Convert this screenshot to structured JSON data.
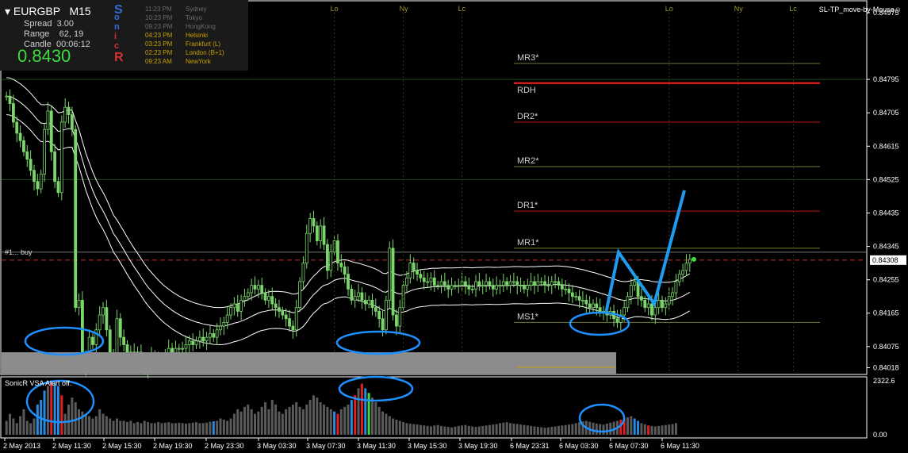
{
  "header": {
    "symbol": "EURGBP",
    "timeframe": "M15",
    "spread_label": "Spread",
    "spread_value": "3.00",
    "range_label": "Range",
    "range_value": "62, 19",
    "candle_label": "Candle",
    "candle_value": "00:06:12",
    "price": "0.8430",
    "sonic_letters": [
      "S",
      "o",
      "n",
      "i",
      "c",
      "R"
    ],
    "sonic_colors": [
      "#2f6fd8",
      "#2f6fd8",
      "#2f6fd8",
      "#d63030",
      "#d63030",
      "#d63030"
    ],
    "sessions": [
      {
        "time": "11:23 PM",
        "name": "Sydney",
        "color": "#6b6b6b"
      },
      {
        "time": "10:23 PM",
        "name": "Tokyo",
        "color": "#6b6b6b"
      },
      {
        "time": "09:23 PM",
        "name": "HongKong",
        "color": "#6b6b6b"
      },
      {
        "time": "04:23 PM",
        "name": "Helsinki",
        "color": "#c8a000"
      },
      {
        "time": "03:23 PM",
        "name": "Frankfurt  (L)",
        "color": "#c8a000"
      },
      {
        "time": "02:23 PM",
        "name": "London  (B+1)",
        "color": "#c8a000"
      },
      {
        "time": "09:23 AM",
        "name": "NewYork",
        "color": "#c8a000"
      }
    ]
  },
  "ea_label": "SL-TP_move-by-Mouse",
  "ea_icon": "smiley-icon",
  "order_label": "#1... buy",
  "vsa_label": "SonicR VSA   Alert off.",
  "chart_data": [
    {
      "type": "candlestick",
      "series_name": "EURGBP,M15",
      "ylim": [
        0.84004,
        0.84992
      ],
      "y_ticks": [
        {
          "v": 0.84975,
          "label": "0.84975"
        },
        {
          "v": 0.84795,
          "label": "0.84795"
        },
        {
          "v": 0.84705,
          "label": "0.84705"
        },
        {
          "v": 0.84615,
          "label": "0.84615"
        },
        {
          "v": 0.84525,
          "label": "0.84525"
        },
        {
          "v": 0.84435,
          "label": "0.84435"
        },
        {
          "v": 0.84345,
          "label": "0.84345"
        },
        {
          "v": 0.84255,
          "label": "0.84255"
        },
        {
          "v": 0.84165,
          "label": "0.84165"
        },
        {
          "v": 0.84075,
          "label": "0.84075"
        },
        {
          "v": 0.84018,
          "label": "0.84018"
        }
      ],
      "current_price": {
        "value": 0.84308,
        "label": "0.84308"
      },
      "grid": false,
      "x_labels": [
        "2 May 2013",
        "2 May 11:30",
        "2 May 15:30",
        "2 May 19:30",
        "2 May 23:30",
        "3 May 03:30",
        "3 May 07:30",
        "3 May 11:30",
        "3 May 15:30",
        "3 May 19:30",
        "6 May 23:31",
        "6 May 03:30",
        "6 May 07:30",
        "6 May 11:30"
      ],
      "session_markers": [
        {
          "label": "Lo",
          "index": 95
        },
        {
          "label": "Ny",
          "index": 115
        },
        {
          "label": "Lc",
          "index": 132
        },
        {
          "label": "Lo",
          "index": 192
        },
        {
          "label": "Ny",
          "index": 212
        },
        {
          "label": "Lc",
          "index": 228
        }
      ],
      "pivot_levels": [
        {
          "label": "MR3*",
          "value": 0.84838,
          "color": "#6b7b2a"
        },
        {
          "label": "RDH",
          "value": 0.84785,
          "color": "#ff2020"
        },
        {
          "label": "DR2*",
          "value": 0.8468,
          "color": "#b81818"
        },
        {
          "label": "MR2*",
          "value": 0.8456,
          "color": "#6b7b2a"
        },
        {
          "label": "DR1*",
          "value": 0.8444,
          "color": "#b81818"
        },
        {
          "label": "MR1*",
          "value": 0.8434,
          "color": "#6b7b2a"
        },
        {
          "label": "MS1*",
          "value": 0.8414,
          "color": "#6b7b2a"
        }
      ],
      "close_prices": [
        0.8475,
        0.8473,
        0.8468,
        0.8465,
        0.8463,
        0.846,
        0.8458,
        0.8455,
        0.8452,
        0.845,
        0.8454,
        0.8466,
        0.8471,
        0.846,
        0.8452,
        0.8449,
        0.8468,
        0.8472,
        0.847,
        0.8466,
        0.8418,
        0.842,
        0.8405,
        0.8402,
        0.841,
        0.8408,
        0.8412,
        0.8416,
        0.8418,
        0.8412,
        0.8405,
        0.8403,
        0.8415,
        0.841,
        0.8408,
        0.8405,
        0.8406,
        0.8404,
        0.8406,
        0.8403,
        0.8401,
        0.8403,
        0.8405,
        0.8404,
        0.8404,
        0.8404,
        0.8405,
        0.8407,
        0.8405,
        0.8407,
        0.8407,
        0.8407,
        0.8408,
        0.8409,
        0.8408,
        0.8409,
        0.841,
        0.8409,
        0.841,
        0.8411,
        0.841,
        0.8412,
        0.8413,
        0.8414,
        0.8416,
        0.8418,
        0.8419,
        0.8417,
        0.842,
        0.8421,
        0.8422,
        0.8424,
        0.8423,
        0.8424,
        0.8422,
        0.842,
        0.8421,
        0.8419,
        0.8418,
        0.8417,
        0.8416,
        0.8415,
        0.8413,
        0.8412,
        0.8418,
        0.8425,
        0.843,
        0.8438,
        0.8442,
        0.844,
        0.8436,
        0.844,
        0.8435,
        0.8428,
        0.8433,
        0.8436,
        0.843,
        0.8429,
        0.8427,
        0.8423,
        0.842,
        0.8421,
        0.8422,
        0.842,
        0.8419,
        0.842,
        0.8418,
        0.8417,
        0.8415,
        0.8412,
        0.842,
        0.8434,
        0.8416,
        0.8413,
        0.8418,
        0.8424,
        0.8426,
        0.843,
        0.8428,
        0.8427,
        0.8426,
        0.8425,
        0.8425,
        0.8426,
        0.8424,
        0.8424,
        0.8425,
        0.8424,
        0.8423,
        0.8424,
        0.8424,
        0.8424,
        0.8425,
        0.8424,
        0.8423,
        0.8423,
        0.8425,
        0.8424,
        0.8424,
        0.8425,
        0.8424,
        0.8423,
        0.8424,
        0.8424,
        0.8425,
        0.8424,
        0.8425,
        0.8425,
        0.8424,
        0.8424,
        0.8423,
        0.8424,
        0.8425,
        0.8424,
        0.8425,
        0.8425,
        0.8424,
        0.8424,
        0.8425,
        0.8425,
        0.8424,
        0.8423,
        0.8423,
        0.8422,
        0.8421,
        0.8421,
        0.842,
        0.842,
        0.8419,
        0.8418,
        0.8419,
        0.8418,
        0.8417,
        0.8417,
        0.8416,
        0.8417,
        0.8415,
        0.8414,
        0.8416,
        0.8418,
        0.8421,
        0.8424,
        0.8425,
        0.8421,
        0.842,
        0.8418,
        0.8419,
        0.8416,
        0.8418,
        0.842,
        0.8418,
        0.8419,
        0.8421,
        0.8422,
        0.8425,
        0.8427,
        0.8428,
        0.843,
        0.8431
      ],
      "marked_low_zones": [
        "2 May 11:30",
        "3 May 11:30",
        "6 May 03:30"
      ]
    },
    {
      "type": "bar",
      "series_name": "SonicR VSA",
      "y_ticks": [
        {
          "v": 2322.6,
          "label": "2322.6"
        },
        {
          "v": 0,
          "label": "0.00"
        }
      ],
      "ylim": [
        0,
        2322.6
      ],
      "volume_colors": {
        "normal": "#5a5a5a",
        "climax_up": "#e02020",
        "climax_down": "#2a8ae0",
        "high": "#2a8ae0",
        "low": "#3ddc3d"
      },
      "volumes": [
        600,
        900,
        700,
        500,
        800,
        1100,
        600,
        500,
        700,
        1300,
        1500,
        1900,
        2100,
        2300,
        2200,
        2100,
        1700,
        900,
        1300,
        1600,
        1400,
        1100,
        1000,
        900,
        800,
        700,
        800,
        1100,
        900,
        800,
        700,
        600,
        700,
        600,
        600,
        550,
        600,
        500,
        550,
        500,
        600,
        550,
        500,
        500,
        550,
        500,
        520,
        540,
        500,
        500,
        520,
        500,
        480,
        500,
        520,
        540,
        500,
        500,
        520,
        560,
        580,
        600,
        700,
        650,
        600,
        700,
        900,
        1100,
        1000,
        1200,
        1300,
        1100,
        900,
        1000,
        1200,
        1400,
        1100,
        1500,
        1300,
        1000,
        900,
        1100,
        1200,
        1300,
        1400,
        1200,
        1100,
        1300,
        1500,
        1700,
        1600,
        1400,
        1300,
        1200,
        1100,
        1000,
        900,
        1100,
        1200,
        1300,
        1500,
        1700,
        2000,
        2200,
        2000,
        1800,
        1600,
        1400,
        1200,
        1000,
        900,
        800,
        700,
        650,
        600,
        550,
        500,
        480,
        460,
        440,
        420,
        400,
        380,
        360,
        400,
        420,
        380,
        360,
        340,
        320,
        350,
        380,
        400,
        420,
        380,
        360,
        340,
        360,
        380,
        400,
        420,
        440,
        460,
        500,
        520,
        540,
        500,
        480,
        460,
        440,
        420,
        400,
        380,
        360,
        340,
        320,
        300,
        320,
        340,
        360,
        380,
        400,
        420,
        440,
        460,
        500,
        540,
        580,
        600,
        560,
        520,
        480,
        460,
        440,
        480,
        520,
        560,
        600,
        650,
        700,
        750,
        800,
        700,
        600,
        500,
        450,
        400,
        380,
        360,
        380,
        400,
        420,
        440,
        460,
        500
      ],
      "colored_bars": {
        "9": "#2a8ae0",
        "10": "#2a8ae0",
        "11": "#2a8ae0",
        "13": "#e02020",
        "14": "#2a8ae0",
        "15": "#2a8ae0",
        "16": "#e02020",
        "60": "#2a8ae0",
        "95": "#2a8ae0",
        "96": "#e02020",
        "100": "#2a8ae0",
        "101": "#e02020",
        "103": "#e02020",
        "104": "#2a8ae0",
        "105": "#3ddc3d",
        "178": "#e02020",
        "179": "#e02020",
        "182": "#2a8ae0",
        "183": "#2a8ae0",
        "186": "#e02020",
        "203": "#e02020"
      }
    }
  ]
}
